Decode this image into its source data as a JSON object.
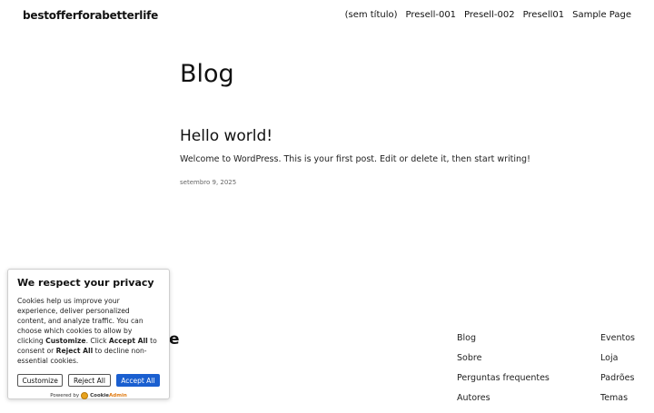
{
  "site": {
    "title": "bestofferforabetterlife"
  },
  "nav": {
    "items": [
      "(sem título)",
      "Presell-001",
      "Presell-002",
      "Presell01",
      "Sample Page"
    ]
  },
  "main": {
    "heading": "Blog",
    "post": {
      "title": "Hello world!",
      "excerpt": "Welcome to WordPress. This is your first post. Edit or delete it, then start writing!",
      "date": "setembro 9, 2025"
    }
  },
  "footer": {
    "fragment": "e",
    "column_a": [
      "Blog",
      "Sobre",
      "Perguntas frequentes",
      "Autores"
    ],
    "column_b": [
      "Eventos",
      "Loja",
      "Padrões",
      "Temas"
    ]
  },
  "cookie": {
    "title": "We respect your privacy",
    "body_1": "Cookies help us improve your experience, deliver personalized content, and analyze traffic. You can choose which cookies to allow by clicking ",
    "body_customize": "Customize",
    "body_2": ". Click ",
    "body_accept": "Accept All",
    "body_3": " to consent or ",
    "body_reject": "Reject All",
    "body_4": " to decline non-essential cookies.",
    "customize_label": "Customize",
    "reject_label": "Reject All",
    "accept_label": "Accept All",
    "powered_by": "Powered by",
    "brand_cookie": "Cookie",
    "brand_admin": "Admin",
    "accent_color": "#1a5fd0"
  }
}
